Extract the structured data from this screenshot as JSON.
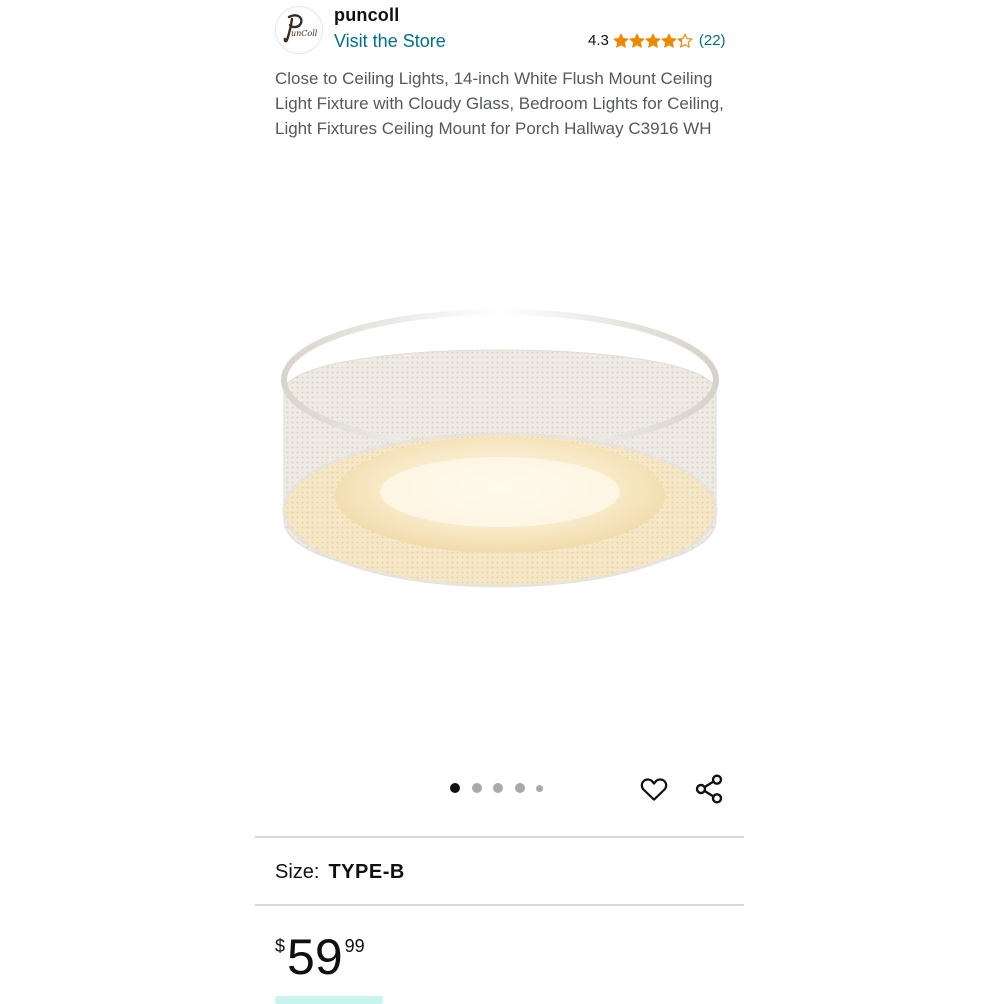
{
  "store": {
    "brand_name": "puncoll",
    "logo_text": "unColl",
    "visit_store_label": "Visit the Store"
  },
  "rating": {
    "value": "4.3",
    "stars": 4.3,
    "count": "(22)",
    "star_color": "#f08804"
  },
  "product": {
    "title": "Close to Ceiling Lights, 14-inch White Flush Mount Ceiling Light Fixture with Cloudy Glass, Bedroom Lights for Ceiling, Light Fixtures Ceiling Mount for Porch Hallway C3916 WH"
  },
  "carousel": {
    "image_count": 5,
    "active_index": 0
  },
  "actions": {
    "favorite_icon": "heart-icon",
    "share_icon": "share-icon"
  },
  "size": {
    "label": "Size:",
    "value": "TYPE-B"
  },
  "price": {
    "symbol": "$",
    "whole": "59",
    "fraction": "99"
  },
  "colors": {
    "link": "#007185",
    "text": "#0f1111",
    "muted": "#565959",
    "divider": "#d5d9d9"
  }
}
